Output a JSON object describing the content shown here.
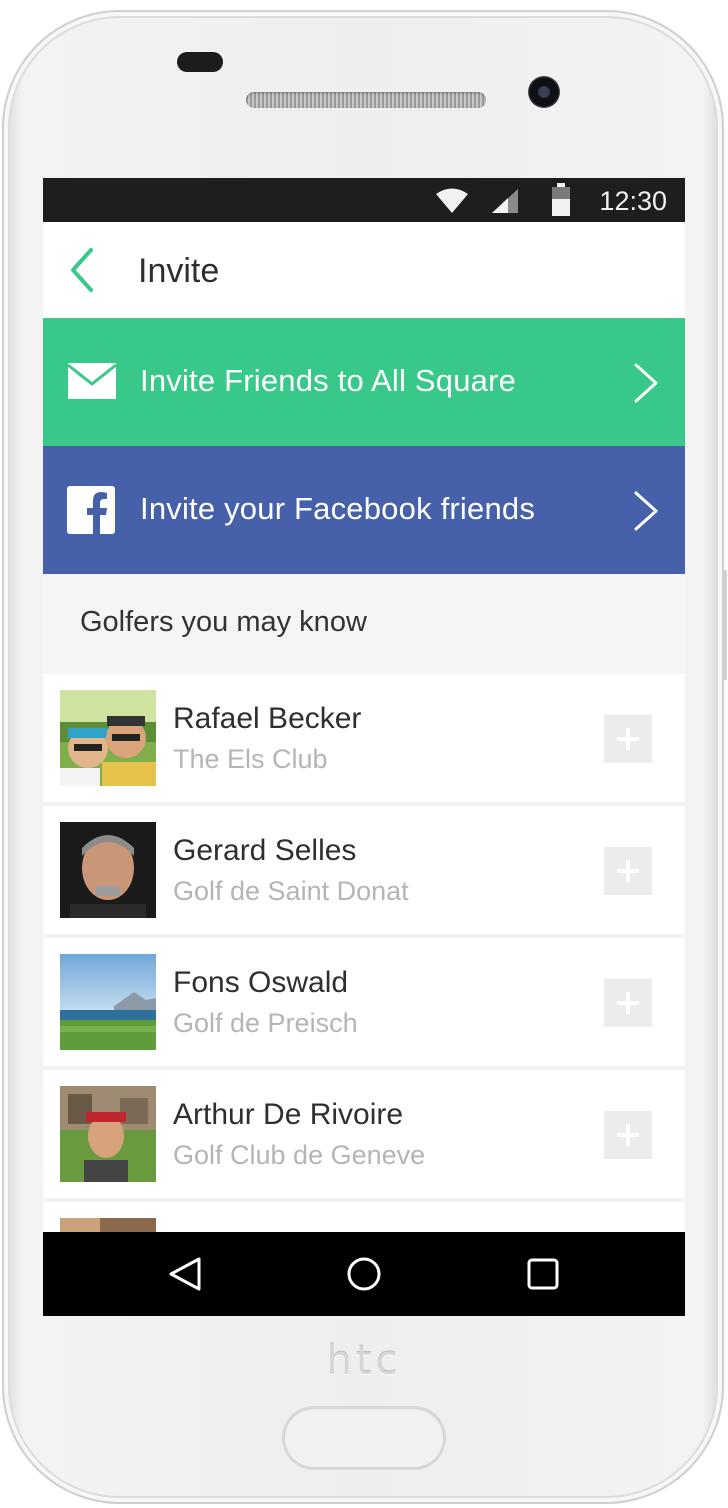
{
  "status_bar": {
    "time": "12:30",
    "icons": [
      "wifi-icon",
      "cell-signal-icon",
      "battery-icon"
    ]
  },
  "app_bar": {
    "title": "Invite",
    "back_icon": "chevron-left-icon"
  },
  "banners": [
    {
      "label": "Invite Friends to All Square",
      "icon": "mail-icon",
      "color": "#38c98a"
    },
    {
      "label": "Invite your Facebook friends",
      "icon": "facebook-icon",
      "color": "#4661aa"
    }
  ],
  "section": {
    "title": "Golfers you may know"
  },
  "golfers": [
    {
      "name": "Rafael Becker",
      "club": "The Els Club"
    },
    {
      "name": "Gerard Selles",
      "club": "Golf de Saint Donat"
    },
    {
      "name": "Fons Oswald",
      "club": "Golf de Preisch"
    },
    {
      "name": "Arthur De Rivoire",
      "club": "Golf Club de Geneve"
    }
  ],
  "nav_bar": {
    "buttons": [
      "back-triangle-icon",
      "home-circle-icon",
      "recents-square-icon"
    ]
  },
  "device": {
    "brand": "htc"
  },
  "colors": {
    "accent_green": "#38c98a",
    "facebook_blue": "#4661aa",
    "secondary_text": "#b5b5b5"
  }
}
